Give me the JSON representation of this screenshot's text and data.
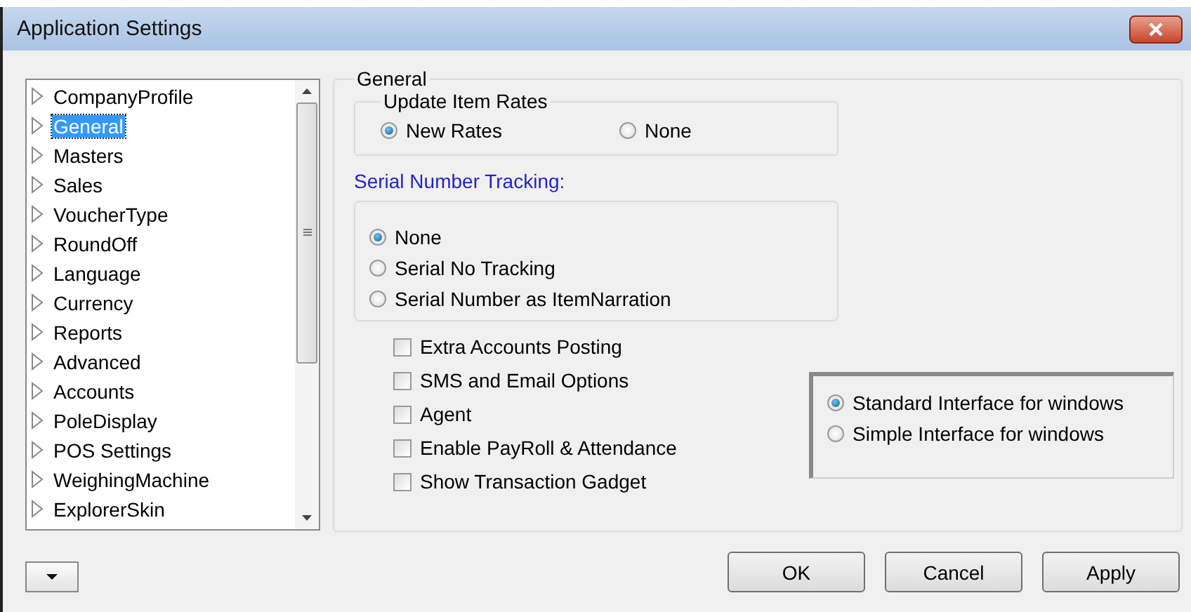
{
  "window": {
    "title": "Application Settings"
  },
  "sidebar": {
    "items": [
      {
        "label": "CompanyProfile",
        "selected": false
      },
      {
        "label": "General",
        "selected": true
      },
      {
        "label": "Masters",
        "selected": false
      },
      {
        "label": "Sales",
        "selected": false
      },
      {
        "label": "VoucherType",
        "selected": false
      },
      {
        "label": "RoundOff",
        "selected": false
      },
      {
        "label": "Language",
        "selected": false
      },
      {
        "label": "Currency",
        "selected": false
      },
      {
        "label": "Reports",
        "selected": false
      },
      {
        "label": "Advanced",
        "selected": false
      },
      {
        "label": "Accounts",
        "selected": false
      },
      {
        "label": "PoleDisplay",
        "selected": false
      },
      {
        "label": "POS Settings",
        "selected": false
      },
      {
        "label": "WeighingMachine",
        "selected": false
      },
      {
        "label": "ExplorerSkin",
        "selected": false
      }
    ]
  },
  "general": {
    "title": "General",
    "update_item_rates": {
      "title": "Update Item Rates",
      "options": [
        {
          "label": "New Rates",
          "selected": true
        },
        {
          "label": "None",
          "selected": false
        }
      ]
    },
    "serial_number_tracking": {
      "title": "Serial Number Tracking:",
      "options": [
        {
          "label": "None",
          "selected": true
        },
        {
          "label": "Serial No Tracking",
          "selected": false
        },
        {
          "label": "Serial Number as ItemNarration",
          "selected": false
        }
      ]
    },
    "checkboxes": [
      {
        "label": "Extra Accounts Posting",
        "checked": false
      },
      {
        "label": "SMS and Email Options",
        "checked": false
      },
      {
        "label": "Agent",
        "checked": false
      },
      {
        "label": "Enable PayRoll & Attendance",
        "checked": false
      },
      {
        "label": "Show Transaction Gadget",
        "checked": false
      }
    ],
    "interface": {
      "options": [
        {
          "label": "Standard Interface for windows",
          "selected": true
        },
        {
          "label": "Simple Interface for windows",
          "selected": false
        }
      ]
    }
  },
  "buttons": [
    "OK",
    "Cancel",
    "Apply"
  ]
}
